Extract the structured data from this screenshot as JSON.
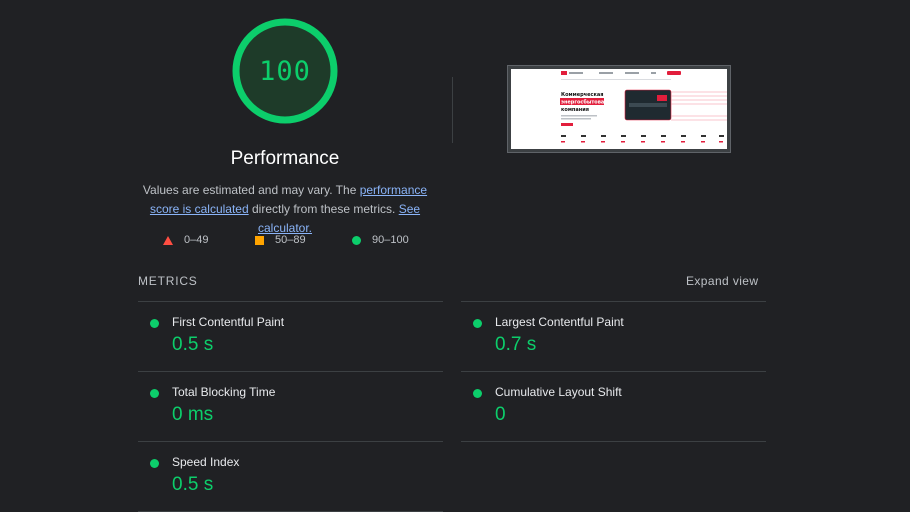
{
  "gauge": {
    "score": "100",
    "label": "Performance",
    "score_fraction": 1.0,
    "color": "#0cce6b"
  },
  "description": {
    "prefix": "Values are estimated and may vary. The ",
    "link1": "performance score is calculated",
    "middle": " directly from these metrics. ",
    "link2": "See calculator."
  },
  "legend": [
    {
      "shape": "triangle",
      "range": "0–49",
      "color": "#ff4e42"
    },
    {
      "shape": "square",
      "range": "50–89",
      "color": "#ffa400"
    },
    {
      "shape": "circle",
      "range": "90–100",
      "color": "#0cce6b"
    }
  ],
  "metrics": {
    "heading": "METRICS",
    "expand_label": "Expand view",
    "items": [
      {
        "label": "First Contentful Paint",
        "value": "0.5 s"
      },
      {
        "label": "Largest Contentful Paint",
        "value": "0.7 s"
      },
      {
        "label": "Total Blocking Time",
        "value": "0 ms"
      },
      {
        "label": "Cumulative Layout Shift",
        "value": "0"
      },
      {
        "label": "Speed Index",
        "value": "0.5 s"
      }
    ]
  },
  "screenshot_page": {
    "headline_line1": "Коммерческая",
    "headline_line2": "энергосбытовая",
    "headline_line3": "компания"
  }
}
